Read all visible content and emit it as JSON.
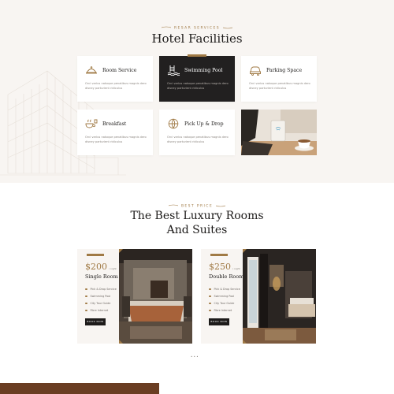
{
  "facilities": {
    "eyebrow": "Resar Services",
    "title": "Hotel Facilities",
    "cards": [
      {
        "title": "Room Service",
        "desc": "Orci varius natoque penatibus magnis dero disney parturient ridiculus",
        "icon": "room-service-icon"
      },
      {
        "title": "Swimming Pool",
        "desc": "Orci varius natoque penatibus magnis dero disney parturient ridiculus",
        "icon": "swimming-pool-icon"
      },
      {
        "title": "Parking Space",
        "desc": "Orci varius natoque penatibus magnis dero disney parturient ridiculus",
        "icon": "parking-car-icon"
      },
      {
        "title": "Breakfast",
        "desc": "Orci varius natoque penatibus magnis dero disney parturient ridiculus",
        "icon": "breakfast-icon"
      },
      {
        "title": "Pick Up & Drop",
        "desc": "Orci varius natoque penatibus magnis dero disney parturient ridiculus",
        "icon": "globe-pickup-icon"
      }
    ]
  },
  "rooms": {
    "eyebrow": "Best Price",
    "title_line1": "The Best Luxury Rooms",
    "title_line2": "And Suites",
    "items": [
      {
        "price": "$200",
        "per": "/ night",
        "name": "Single Room",
        "features": [
          "Pick & Drop Service",
          "Swimming Pool",
          "City Tour Guide",
          "Fibre Internet"
        ],
        "book": "BOOK NOW"
      },
      {
        "price": "$250",
        "per": "/ night",
        "name": "Double Room",
        "features": [
          "Pick & Drop Service",
          "Swimming Pool",
          "City Tour Guide",
          "Fibre Internet"
        ],
        "book": "BOOK NOW"
      }
    ],
    "pager": "• • •"
  },
  "colors": {
    "accent": "#a07a45",
    "dark": "#222020",
    "section_bg": "#f8f5f2"
  }
}
